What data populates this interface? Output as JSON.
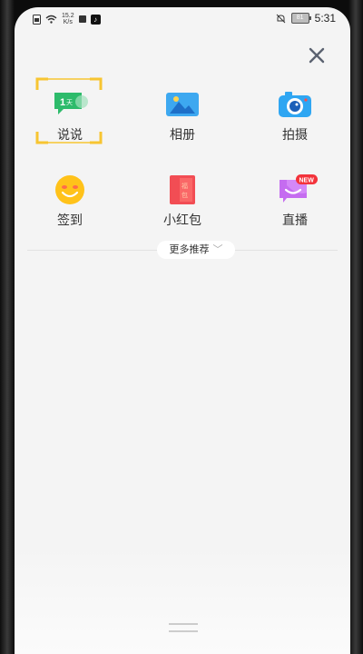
{
  "status_bar": {
    "net_speed_value": "15.2",
    "net_speed_unit": "K/s",
    "battery": "81",
    "time": "5:31",
    "icons": [
      "sim-card-icon",
      "wifi-icon",
      "square-icon",
      "tiktok-icon",
      "mute-bell-icon",
      "battery-icon"
    ]
  },
  "close": {
    "icon": "close-icon"
  },
  "grid": {
    "items": [
      {
        "label": "说说",
        "icon": "talk-icon",
        "selected": true
      },
      {
        "label": "相册",
        "icon": "photo-album-icon"
      },
      {
        "label": "拍摄",
        "icon": "camera-icon"
      },
      {
        "label": "签到",
        "icon": "smiley-checkin-icon"
      },
      {
        "label": "小红包",
        "icon": "red-packet-icon"
      },
      {
        "label": "直播",
        "icon": "live-icon",
        "badge": "NEW"
      }
    ]
  },
  "more": {
    "label": "更多推荐",
    "icon": "chevron-down-icon"
  }
}
